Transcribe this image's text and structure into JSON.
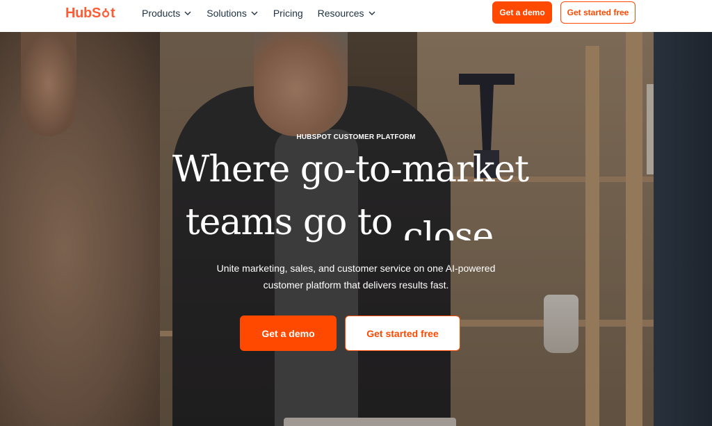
{
  "nav": {
    "logo_text_before": "HubS",
    "logo_text_after": "t",
    "logo_icon": "sprocket-icon",
    "items": [
      {
        "label": "Products",
        "has_dropdown": true
      },
      {
        "label": "Solutions",
        "has_dropdown": true
      },
      {
        "label": "Pricing",
        "has_dropdown": false
      },
      {
        "label": "Resources",
        "has_dropdown": true
      }
    ],
    "demo_label": "Get a demo",
    "free_label": "Get started free"
  },
  "hero": {
    "eyebrow": "HUBSPOT CUSTOMER PLATFORM",
    "headline_line1": "Where go-to-market",
    "headline_line2": "teams go to ",
    "headline_rotating_word": "close",
    "subtext_line1": "Unite marketing, sales, and customer service on one AI-powered",
    "subtext_line2": "customer platform that delivers results fast.",
    "demo_label": "Get a demo",
    "free_label": "Get started free"
  },
  "colors": {
    "brand_orange": "#ff4800",
    "logo_orange": "#ff5c35",
    "nav_text": "#213343"
  }
}
